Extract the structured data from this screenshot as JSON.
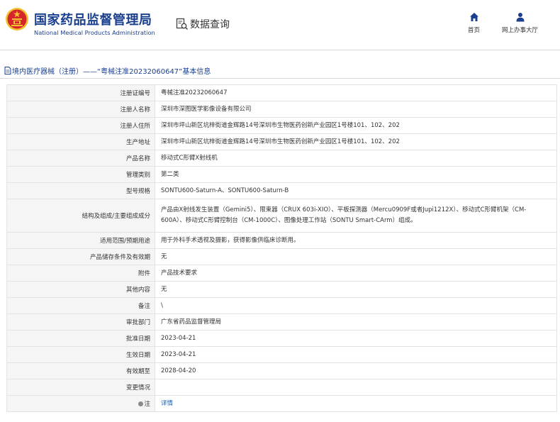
{
  "header": {
    "brand_cn": "国家药品监督管理局",
    "brand_en": "National Medical Products Administration",
    "query_label": "数据查询",
    "nav": {
      "home": "首页",
      "hall": "网上办事大厅"
    },
    "colors": {
      "brand": "#1a3f8f",
      "emblem_red": "#d4262b",
      "emblem_gold": "#f2c230"
    }
  },
  "section_title": "境内医疗器械（注册）——“粤械注准20232060647”基本信息",
  "rows": [
    {
      "label": "注册证编号",
      "value": "粤械注准20232060647"
    },
    {
      "label": "注册人名称",
      "value": "深圳市深图医学影像设备有限公司"
    },
    {
      "label": "注册人住所",
      "value": "深圳市坪山新区坑梓街道金辉路14号深圳市生物医药创新产业园区1号楼101、102、202"
    },
    {
      "label": "生产地址",
      "value": "深圳市坪山新区坑梓街道金辉路14号深圳市生物医药创新产业园区1号楼101、102、202"
    },
    {
      "label": "产品名称",
      "value": "移动式C形臂X射线机"
    },
    {
      "label": "管理类别",
      "value": "第二类"
    },
    {
      "label": "型号规格",
      "value": "SONTU600-Saturn-A、SONTU600-Saturn-B"
    },
    {
      "label": "结构及组成/主要组成成分",
      "value": "产品由X射线发生装置（Gemini5）、限束器（CRUX 603i-XIO）、平板探测器（Mercu0909F或者Jupi1212X）、移动式C形臂机架（CM-600A）、移动式C形臂控制台（CM-1000C）、图像处理工作站（SONTU Smart-CArm）组成。"
    },
    {
      "label": "适用范围/预期用途",
      "value": "用于外科手术透视及摄影，获得影像供临床诊断用。"
    },
    {
      "label": "产品储存条件及有效期",
      "value": "无"
    },
    {
      "label": "附件",
      "value": "产品技术要求"
    },
    {
      "label": "其他内容",
      "value": "无"
    },
    {
      "label": "备注",
      "value": "\\"
    },
    {
      "label": "审批部门",
      "value": "广东省药品监督管理局"
    },
    {
      "label": "批准日期",
      "value": "2023-04-21"
    },
    {
      "label": "生效日期",
      "value": "2023-04-21"
    },
    {
      "label": "有效期至",
      "value": "2028-04-20"
    },
    {
      "label": "变更情况",
      "value": ""
    },
    {
      "label": "注",
      "value": "详情",
      "link": true,
      "label_icon": "info-dot-icon"
    }
  ]
}
